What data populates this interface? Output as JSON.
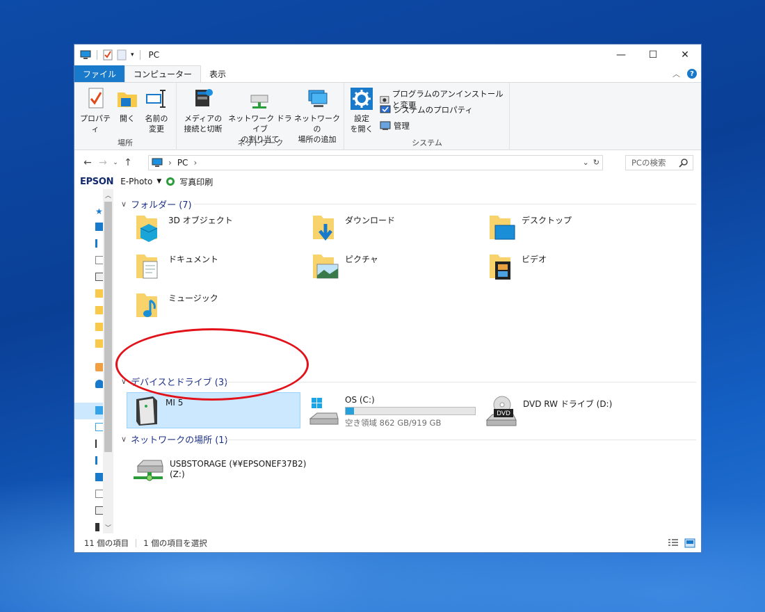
{
  "window": {
    "title": "PC",
    "controls": {
      "minimize": "—",
      "maximize": "☐",
      "close": "✕"
    }
  },
  "tabs": {
    "file": "ファイル",
    "computer": "コンピューター",
    "view": "表示"
  },
  "ribbon": {
    "location": {
      "label": "場所",
      "properties": "プロパティ",
      "open": "開く",
      "rename_1": "名前の",
      "rename_2": "変更"
    },
    "network": {
      "label": "ネットワーク",
      "media_1": "メディアの",
      "media_2": "接続と切断",
      "map_drive_1": "ネットワーク ドライブ",
      "map_drive_2": "の割り当て",
      "add_location_1": "ネットワークの",
      "add_location_2": "場所の追加"
    },
    "system": {
      "label": "システム",
      "settings_1": "設定",
      "settings_2": "を開く",
      "uninstall": "プログラムのアンインストールと変更",
      "sys_props": "システムのプロパティ",
      "manage": "管理"
    }
  },
  "address": {
    "path": "PC",
    "search_placeholder": "PCの検索"
  },
  "epson": {
    "logo": "EPSON",
    "app": "E-Photo",
    "print": "写真印刷"
  },
  "groups": {
    "folders": "フォルダー (7)",
    "devices": "デバイスとドライブ (3)",
    "network": "ネットワークの場所 (1)"
  },
  "folders": [
    {
      "name": "3D オブジェクト"
    },
    {
      "name": "ダウンロード"
    },
    {
      "name": "デスクトップ"
    },
    {
      "name": "ドキュメント"
    },
    {
      "name": "ピクチャ"
    },
    {
      "name": "ビデオ"
    },
    {
      "name": "ミュージック"
    }
  ],
  "devices": [
    {
      "name": "MI 5"
    },
    {
      "name": "OS (C:)",
      "free_text": "空き領域 862 GB/919 GB",
      "used_fraction": 0.062
    },
    {
      "name": "DVD RW ドライブ (D:)",
      "badge": "DVD"
    }
  ],
  "network_locations": [
    {
      "name_1": "USBSTORAGE (¥¥EPSONEF37B2)",
      "name_2": "(Z:)"
    }
  ],
  "status": {
    "count": "11 個の項目",
    "selected": "1 個の項目を選択"
  },
  "colors": {
    "accent": "#1979ca",
    "selection": "#cce8ff",
    "annotation": "#e2111a",
    "progress": "#26a0da"
  }
}
